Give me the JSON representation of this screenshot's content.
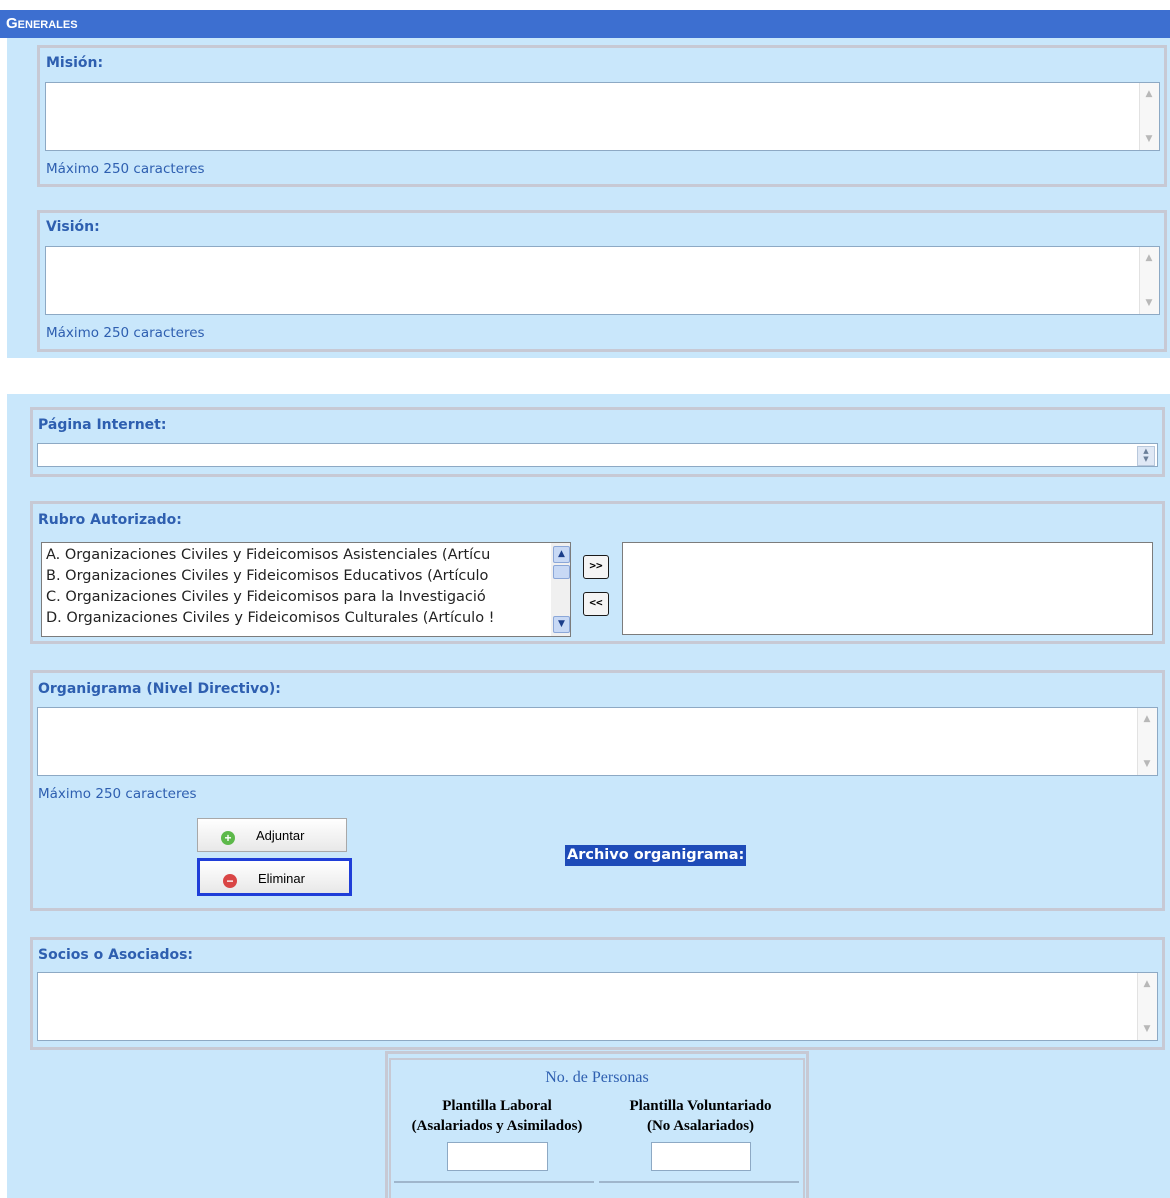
{
  "header": {
    "title": "Generales"
  },
  "mision": {
    "label": "Misión:",
    "value": "",
    "hint": "Máximo 250 caracteres"
  },
  "vision": {
    "label": "Visión:",
    "value": "",
    "hint": "Máximo 250 caracteres"
  },
  "pagina_internet": {
    "label": "Página Internet:",
    "value": ""
  },
  "rubro": {
    "label": "Rubro Autorizado:",
    "available": [
      "A. Organizaciones Civiles y Fideicomisos Asistenciales (Artícu",
      "B. Organizaciones Civiles y Fideicomisos Educativos (Artículo",
      "C. Organizaciones Civiles y Fideicomisos para la Investigació",
      "D. Organizaciones Civiles y Fideicomisos Culturales (Artículo !"
    ],
    "add_label": ">>",
    "remove_label": "<<",
    "selected": []
  },
  "organigrama": {
    "label": "Organigrama (Nivel Directivo):",
    "value": "",
    "hint": "Máximo 250 caracteres",
    "attach_label": "Adjuntar",
    "delete_label": "Eliminar",
    "file_label": "Archivo organigrama:"
  },
  "socios": {
    "label": "Socios o Asociados:",
    "value": ""
  },
  "personas": {
    "title": "No. de Personas",
    "laboral_line1": "Plantilla Laboral",
    "laboral_line2": "(Asalariados y Asimilados)",
    "voluntariado_line1": "Plantilla Voluntariado",
    "voluntariado_line2": "(No Asalariados)",
    "laboral_value": "",
    "voluntariado_value": ""
  },
  "colors": {
    "header_bg": "#3d6fd0",
    "panel_bg": "#c9e7fb",
    "label_text": "#2e5fb0",
    "fieldset_border": "#c7c9d4"
  }
}
